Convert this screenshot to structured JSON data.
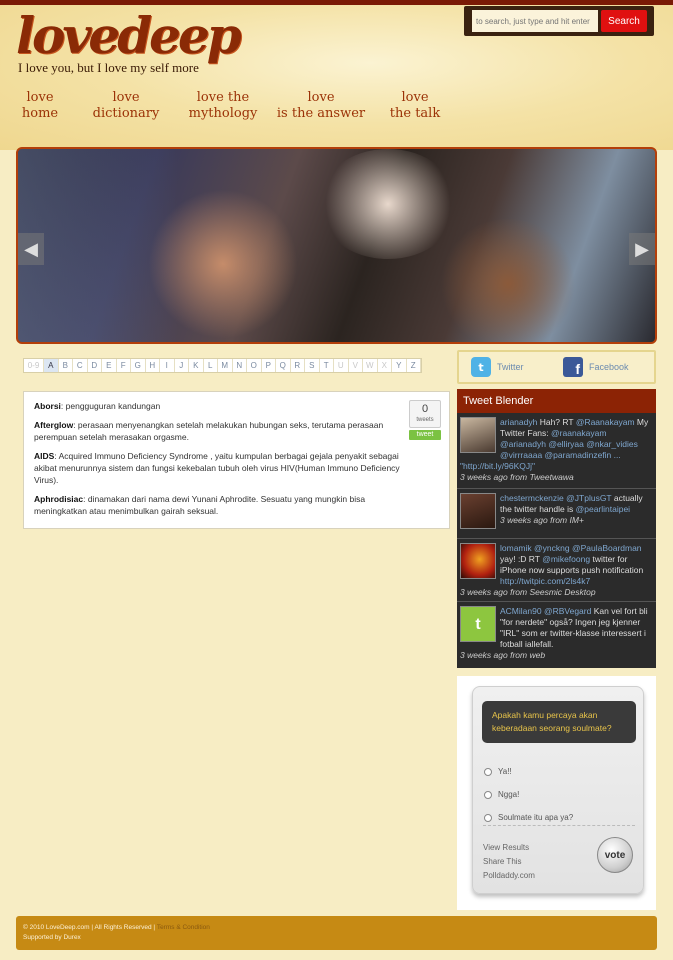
{
  "site": {
    "logo": "lovedeep",
    "tagline": "I love you, but I love my self more"
  },
  "search": {
    "placeholder": "to search, just type and hit enter",
    "button": "Search"
  },
  "nav": [
    {
      "line1": "love",
      "line2": "home"
    },
    {
      "line1": "love",
      "line2": "dictionary"
    },
    {
      "line1": "love the",
      "line2": "mythology"
    },
    {
      "line1": "love",
      "line2": "is the answer"
    },
    {
      "line1": "love",
      "line2": "the talk"
    }
  ],
  "slider": {
    "prev": "◀",
    "next": "▶"
  },
  "alphabet": [
    "0-9",
    "A",
    "B",
    "C",
    "D",
    "E",
    "F",
    "G",
    "H",
    "I",
    "J",
    "K",
    "L",
    "M",
    "N",
    "O",
    "P",
    "Q",
    "R",
    "S",
    "T",
    "U",
    "V",
    "W",
    "X",
    "Y",
    "Z"
  ],
  "alphabet_active": "A",
  "alphabet_disabled": [
    "0-9",
    "U",
    "V",
    "W",
    "X"
  ],
  "dictionary": {
    "entries": [
      {
        "term": "Aborsi",
        "definition": ": pengguguran kandungan"
      },
      {
        "term": "Afterglow",
        "definition": ": perasaan menyenangkan setelah melakukan hubungan seks, terutama perasaan perempuan setelah merasakan orgasme."
      },
      {
        "term": "AIDS",
        "definition": ": Acquired Immuno Deficiency Syndrome , yaitu kumpulan berbagai gejala  penyakit sebagai akibat menurunnya sistem dan fungsi kekebalan tubuh oleh virus HIV(Human Immuno Deficiency Virus)."
      },
      {
        "term": "Aphrodisiac",
        "definition": ": dinamakan dari nama dewi Yunani Aphrodite. Sesuatu yang mungkin bisa meningkatkan atau menimbulkan gairah seksual."
      }
    ],
    "tweet_count": "0",
    "tweet_count_label": "tweets",
    "tweet_button": "tweet"
  },
  "social": {
    "twitter": "Twitter",
    "facebook": "Facebook"
  },
  "tweet_blender": {
    "title": "Tweet Blender",
    "tweets": [
      {
        "user": "arianadyh",
        "text_a": "Hah? RT",
        "mention1": "@Raanakayam",
        "text_b": "My Twitter Fans:",
        "mention2": "@raanakayam @arianadyh @elliryaa @nkar_vidies @virrraaaa @paramadinzefin ...",
        "link": "\"http://bit.ly/96KQJj\"",
        "time": "3 weeks ago from",
        "source": "Tweetwawa"
      },
      {
        "user": "chestermckenzie",
        "mention1": "@JTplusGT",
        "text_b": "actually the twitter handle is",
        "mention2": "@pearlintaipei",
        "time": "3 weeks ago from",
        "source": "IM+"
      },
      {
        "user": "lomamik",
        "mention1": "@ynckng @PaulaBoardman",
        "text_a": "yay! :D RT",
        "mention2": "@mikefoong",
        "text_b": "twitter for iPhone now supports push notification",
        "link": "http://twitpic.com/2ls4k7",
        "time": "3 weeks ago from",
        "source": "Seesmic Desktop"
      },
      {
        "user": "ACMilan90",
        "mention1": "@RBVegard",
        "text_b": "Kan vel fort bli \"for nerdete\" også? Ingen jeg kjenner \"IRL\" som er twitter-klasse interessert i fotball iallefall.",
        "time": "3 weeks ago from",
        "source": "web"
      }
    ]
  },
  "poll": {
    "question": "Apakah kamu percaya akan keberadaan seorang soulmate?",
    "options": [
      "Ya!!",
      "Ngga!",
      "Soulmate itu apa ya?"
    ],
    "view_results": "View Results",
    "share": "Share This",
    "polldaddy": "Polldaddy.com",
    "vote": "vote"
  },
  "footer": {
    "copyright": "© 2010 LoveDeep.com | All Rights Reserved |",
    "link": "Terms & Condition",
    "supported": "Supported by Durex"
  },
  "colors": {
    "brand": "#8a2a06",
    "nav": "#9b3207",
    "footer": "#c68a14",
    "search_button": "#e01010",
    "tweet_header": "#8c2305"
  }
}
